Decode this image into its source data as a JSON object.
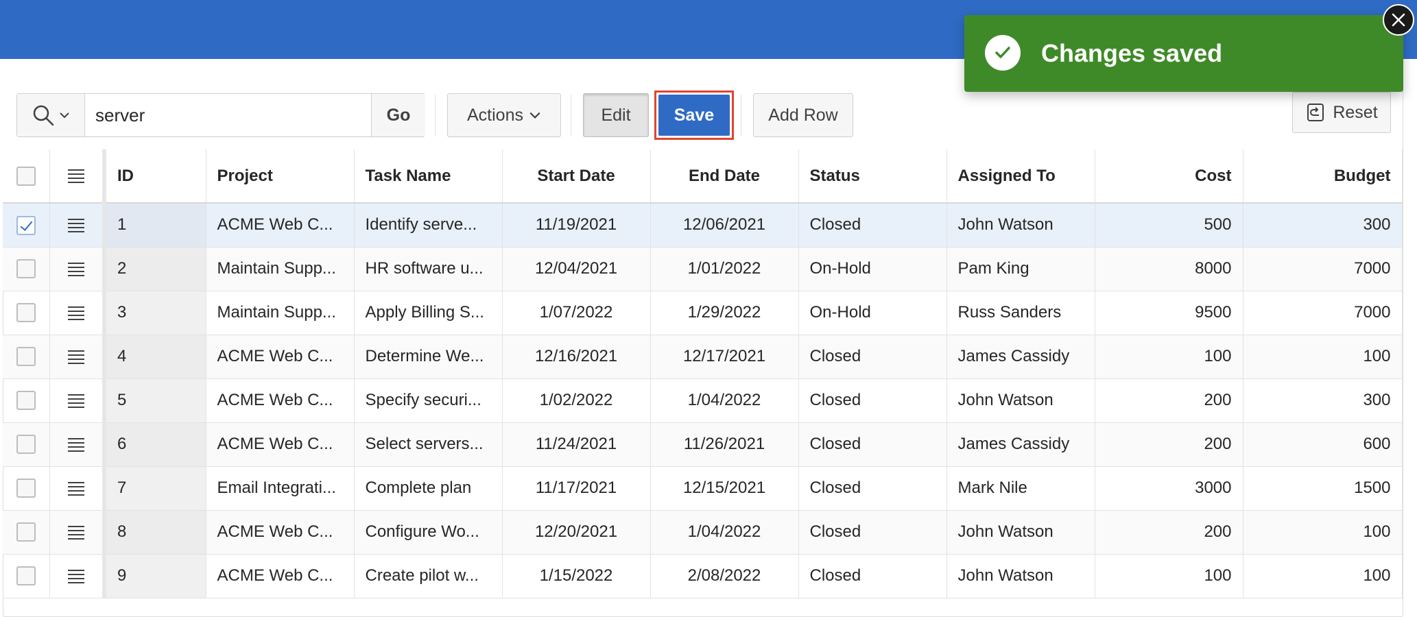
{
  "toolbar": {
    "search_value": "server",
    "go_label": "Go",
    "actions_label": "Actions",
    "edit_label": "Edit",
    "save_label": "Save",
    "add_row_label": "Add Row",
    "reset_label": "Reset"
  },
  "grid": {
    "columns": [
      "ID",
      "Project",
      "Task Name",
      "Start Date",
      "End Date",
      "Status",
      "Assigned To",
      "Cost",
      "Budget"
    ],
    "rows": [
      {
        "checked": true,
        "id": "1",
        "project": "ACME Web C...",
        "task": "Identify serve...",
        "start": "11/19/2021",
        "end": "12/06/2021",
        "status": "Closed",
        "assigned": "John Watson",
        "cost": "500",
        "budget": "300"
      },
      {
        "checked": false,
        "id": "2",
        "project": "Maintain Supp...",
        "task": "HR software u...",
        "start": "12/04/2021",
        "end": "1/01/2022",
        "status": "On-Hold",
        "assigned": "Pam King",
        "cost": "8000",
        "budget": "7000"
      },
      {
        "checked": false,
        "id": "3",
        "project": "Maintain Supp...",
        "task": "Apply Billing S...",
        "start": "1/07/2022",
        "end": "1/29/2022",
        "status": "On-Hold",
        "assigned": "Russ Sanders",
        "cost": "9500",
        "budget": "7000"
      },
      {
        "checked": false,
        "id": "4",
        "project": "ACME Web C...",
        "task": "Determine We...",
        "start": "12/16/2021",
        "end": "12/17/2021",
        "status": "Closed",
        "assigned": "James Cassidy",
        "cost": "100",
        "budget": "100"
      },
      {
        "checked": false,
        "id": "5",
        "project": "ACME Web C...",
        "task": "Specify securi...",
        "start": "1/02/2022",
        "end": "1/04/2022",
        "status": "Closed",
        "assigned": "John Watson",
        "cost": "200",
        "budget": "300"
      },
      {
        "checked": false,
        "id": "6",
        "project": "ACME Web C...",
        "task": "Select servers...",
        "start": "11/24/2021",
        "end": "11/26/2021",
        "status": "Closed",
        "assigned": "James Cassidy",
        "cost": "200",
        "budget": "600"
      },
      {
        "checked": false,
        "id": "7",
        "project": "Email Integrati...",
        "task": "Complete plan",
        "start": "11/17/2021",
        "end": "12/15/2021",
        "status": "Closed",
        "assigned": "Mark Nile",
        "cost": "3000",
        "budget": "1500"
      },
      {
        "checked": false,
        "id": "8",
        "project": "ACME Web C...",
        "task": "Configure Wo...",
        "start": "12/20/2021",
        "end": "1/04/2022",
        "status": "Closed",
        "assigned": "John Watson",
        "cost": "200",
        "budget": "100"
      },
      {
        "checked": false,
        "id": "9",
        "project": "ACME Web C...",
        "task": "Create pilot w...",
        "start": "1/15/2022",
        "end": "2/08/2022",
        "status": "Closed",
        "assigned": "John Watson",
        "cost": "100",
        "budget": "100"
      }
    ]
  },
  "toast": {
    "message": "Changes saved"
  },
  "colors": {
    "header": "#2f6bc4",
    "primary_button": "#2f6bc4",
    "save_highlight": "#e0452e",
    "toast_success": "#3f8a28"
  },
  "icons": [
    "search-icon",
    "chevron-down-icon",
    "row-actions-icon",
    "reset-icon",
    "check-icon",
    "close-icon"
  ]
}
